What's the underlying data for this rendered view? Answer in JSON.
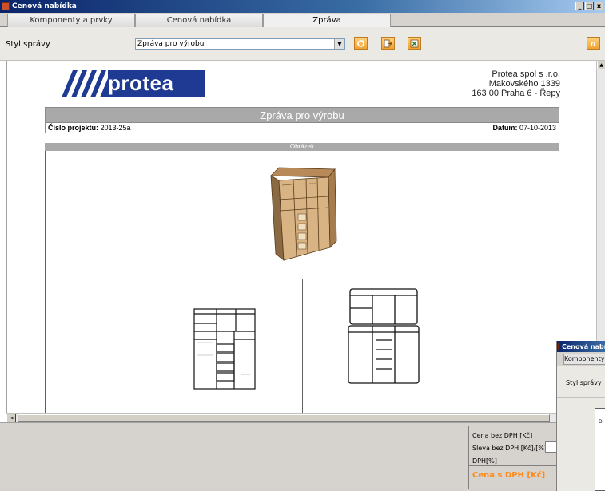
{
  "window": {
    "title": "Cenová nabídka",
    "minimize": "_",
    "restore": "□",
    "close": "x"
  },
  "tabs": [
    {
      "label": "Komponenty a prvky"
    },
    {
      "label": "Cenová nabídka"
    },
    {
      "label": "Zpráva"
    }
  ],
  "toolbar": {
    "style_label": "Styl správy",
    "style_value": "Zpráva pro výrobu",
    "dropdown_arrow": "▼",
    "buttons": [
      "refresh-icon",
      "export-icon",
      "excel-icon",
      "about-icon"
    ],
    "about_glyph": "a"
  },
  "report": {
    "logo_text": "protea",
    "company": {
      "name": "Protea spol s .r.o.",
      "street": "Makovského 1339",
      "city": "163 00 Praha 6 - Řepy"
    },
    "title": "Zpráva pro výrobu",
    "project_label": "Číslo projektu:",
    "project_value": "2013-25a",
    "date_label": "Datum:",
    "date_value": "07-10-2013",
    "section_header": "Obrázek"
  },
  "scroll": {
    "up_arrow": "▲",
    "left_arrow": "◄"
  },
  "price_panel": {
    "price_no_vat": "Cena bez DPH [Kč]",
    "discount": "Sleva bez DPH [Kč]/[%]",
    "vat": "DPH[%]",
    "price_with_vat": "Cena s DPH [Kč]"
  },
  "second_window": {
    "title": "Cenová nabídka",
    "tab_label": "Komponenty a prvky",
    "style_label": "Styl správy",
    "cell_text": "D"
  },
  "colors": {
    "title_bar": "#0a246a",
    "logo_bg": "#1f3a93",
    "header_gray": "#a9a9a9",
    "total_orange": "#ff8a1a",
    "button_orange": "#f0a030"
  }
}
